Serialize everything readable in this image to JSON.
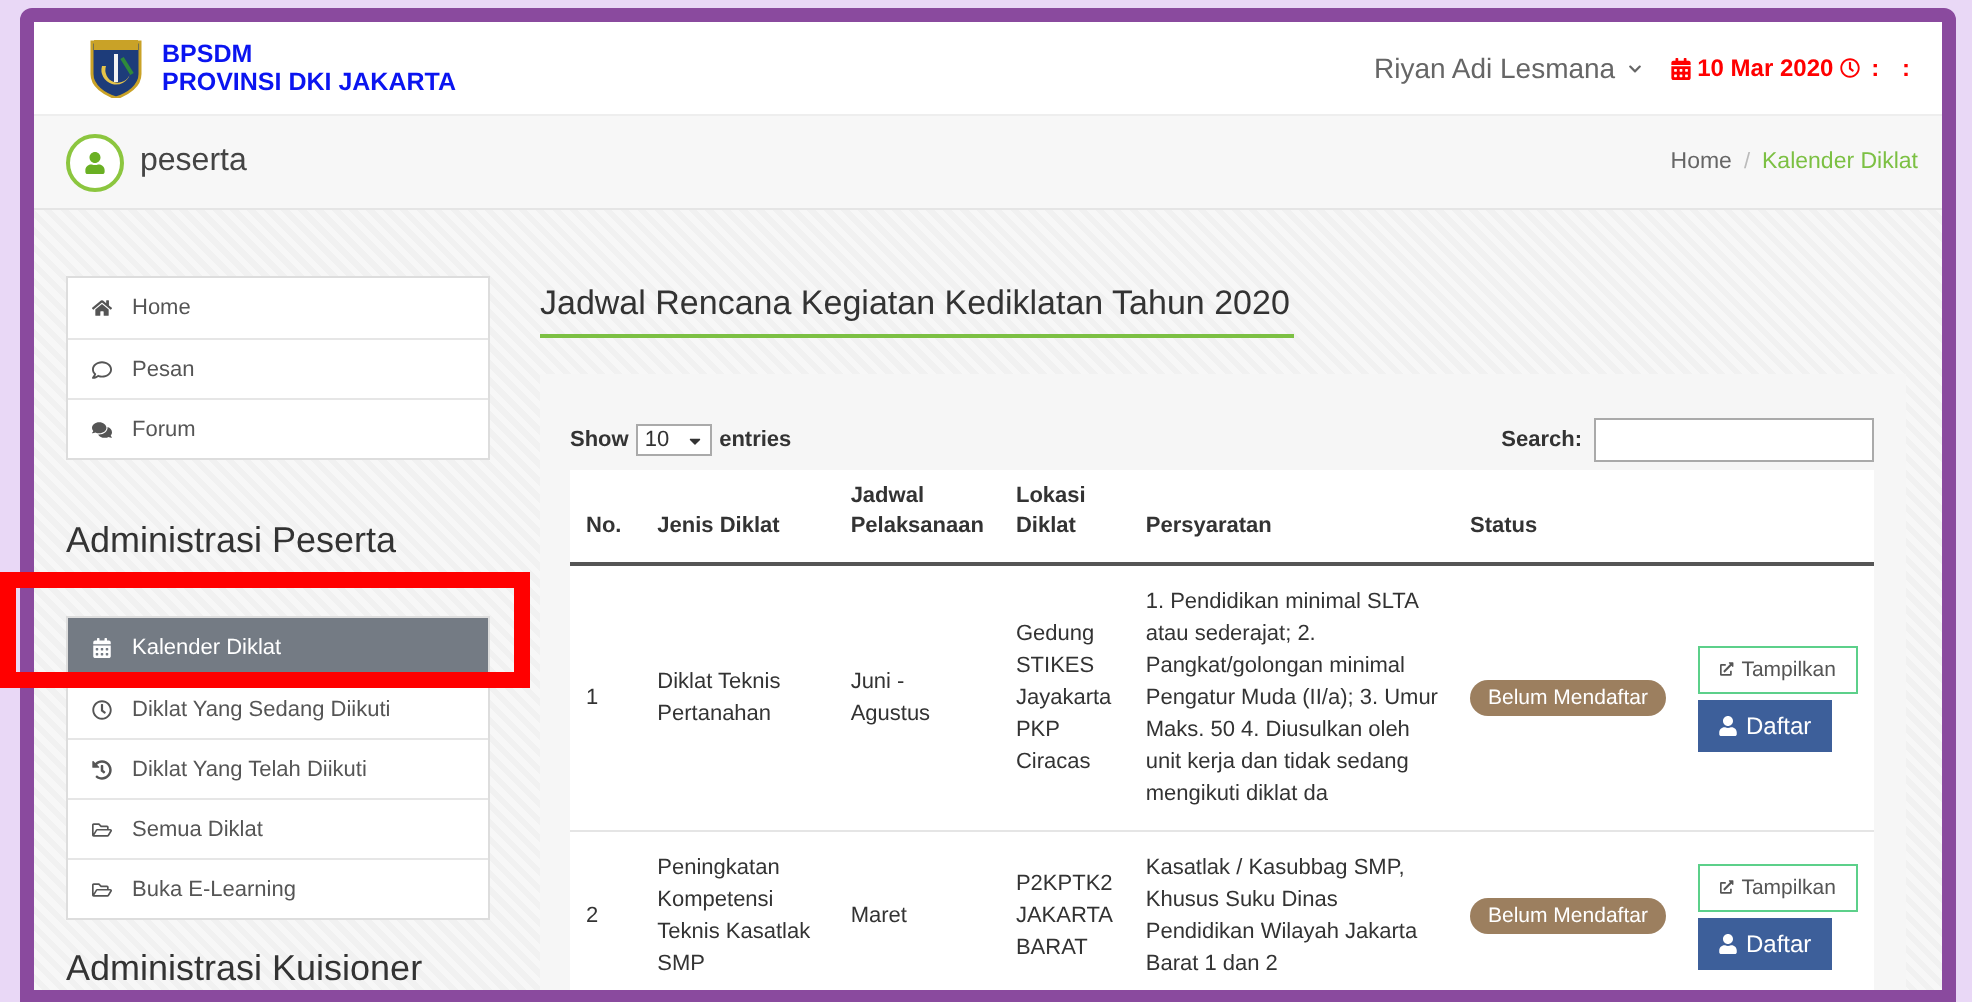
{
  "brand": {
    "line1": "BPSDM",
    "line2": "PROVINSI DKI JAKARTA"
  },
  "user_menu": {
    "name": "Riyan Adi Lesmana"
  },
  "date": "10 Mar 2020",
  "clock": ": :",
  "page_title": "peserta",
  "breadcrumb_separator": "/",
  "breadcrumb": [
    {
      "label": "Home",
      "selected": false
    },
    {
      "label": "Kalender Diklat",
      "selected": true
    }
  ],
  "sidebar_top": [
    {
      "label": "Home",
      "selected": false
    },
    {
      "label": "Pesan",
      "selected": false
    },
    {
      "label": "Forum",
      "selected": false
    }
  ],
  "sections": [
    {
      "title": "Administrasi Peserta",
      "items": [
        {
          "label": "Kalender Diklat",
          "selected": true
        },
        {
          "label": "Diklat Yang Sedang Diikuti",
          "selected": false
        },
        {
          "label": "Diklat Yang Telah Diikuti",
          "selected": false
        },
        {
          "label": "Semua Diklat",
          "selected": false
        },
        {
          "label": "Buka E-Learning",
          "selected": false
        }
      ]
    },
    {
      "title": "Administrasi Kuisioner"
    }
  ],
  "content_title": "Jadwal Rencana Kegiatan Kediklatan Tahun 2020",
  "length_control": {
    "before": "Show",
    "value": "10",
    "after": "entries"
  },
  "search": {
    "label": "Search:"
  },
  "table": {
    "columns": [
      "No.",
      "Jenis Diklat",
      "Jadwal Pelaksanaan",
      "Lokasi Diklat",
      "Persyaratan",
      "Status"
    ],
    "rows": [
      {
        "no": "1",
        "jenis": "Diklat Teknis Pertanahan",
        "jadwal": "Juni - Agustus",
        "lokasi": "Gedung STIKES Jayakarta PKP Ciracas",
        "persyaratan": "1. Pendidikan minimal SLTA atau sederajat; 2. Pangkat/golongan minimal Pengatur Muda (II/a); 3. Umur Maks. 50 4. Diusulkan oleh unit kerja dan tidak sedang mengikuti diklat da",
        "status": "Belum Mendaftar",
        "view": "Tampilkan",
        "register": "Daftar"
      },
      {
        "no": "2",
        "jenis": "Peningkatan Kompetensi Teknis Kasatlak SMP",
        "jadwal": "Maret",
        "lokasi": "P2KPTK2 JAKARTA BARAT",
        "persyaratan": "Kasatlak / Kasubbag SMP, Khusus Suku Dinas Pendidikan Wilayah Jakarta Barat 1 dan 2",
        "status": "Belum Mendaftar",
        "view": "Tampilkan",
        "register": "Daftar"
      }
    ]
  },
  "annotation": {
    "kind": "highlight"
  }
}
